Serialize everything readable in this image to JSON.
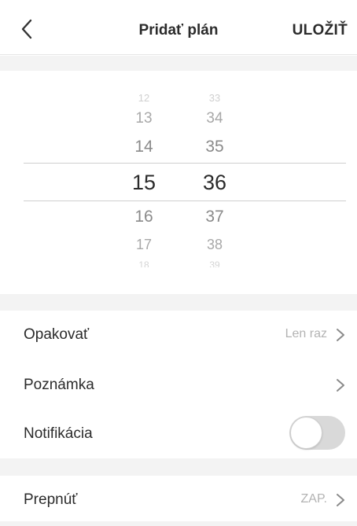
{
  "header": {
    "title": "Pridať plán",
    "save_label": "ULOŽIŤ"
  },
  "picker": {
    "hours": [
      "12",
      "13",
      "14",
      "15",
      "16",
      "17",
      "18"
    ],
    "minutes": [
      "33",
      "34",
      "35",
      "36",
      "37",
      "38",
      "39"
    ],
    "selected_hour": "15",
    "selected_minute": "36"
  },
  "settings": {
    "repeat": {
      "label": "Opakovať",
      "value": "Len raz"
    },
    "note": {
      "label": "Poznámka"
    },
    "notification": {
      "label": "Notifikácia",
      "enabled": false
    },
    "switch": {
      "label": "Prepnúť",
      "value": "ZAP."
    }
  }
}
